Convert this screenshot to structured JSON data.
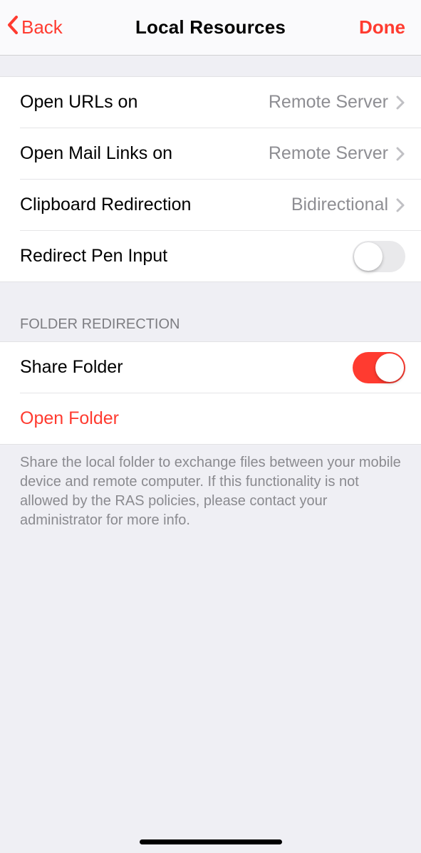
{
  "nav": {
    "back_label": "Back",
    "title": "Local Resources",
    "done_label": "Done"
  },
  "rows": {
    "open_urls": {
      "label": "Open URLs on",
      "value": "Remote Server"
    },
    "open_mail": {
      "label": "Open Mail Links on",
      "value": "Remote Server"
    },
    "clipboard": {
      "label": "Clipboard Redirection",
      "value": "Bidirectional"
    },
    "redirect_pen": {
      "label": "Redirect Pen Input",
      "on": false
    },
    "share_folder": {
      "label": "Share Folder",
      "on": true
    },
    "open_folder": {
      "label": "Open Folder"
    }
  },
  "folder_section": {
    "header": "FOLDER REDIRECTION",
    "footer": "Share the local folder to exchange files between your mobile device and remote computer. If this functionality is not allowed by the RAS policies, please contact your administrator for more info."
  },
  "colors": {
    "accent": "#ff3b30",
    "bg": "#efeff4",
    "secondary_text": "#8e8e93"
  }
}
